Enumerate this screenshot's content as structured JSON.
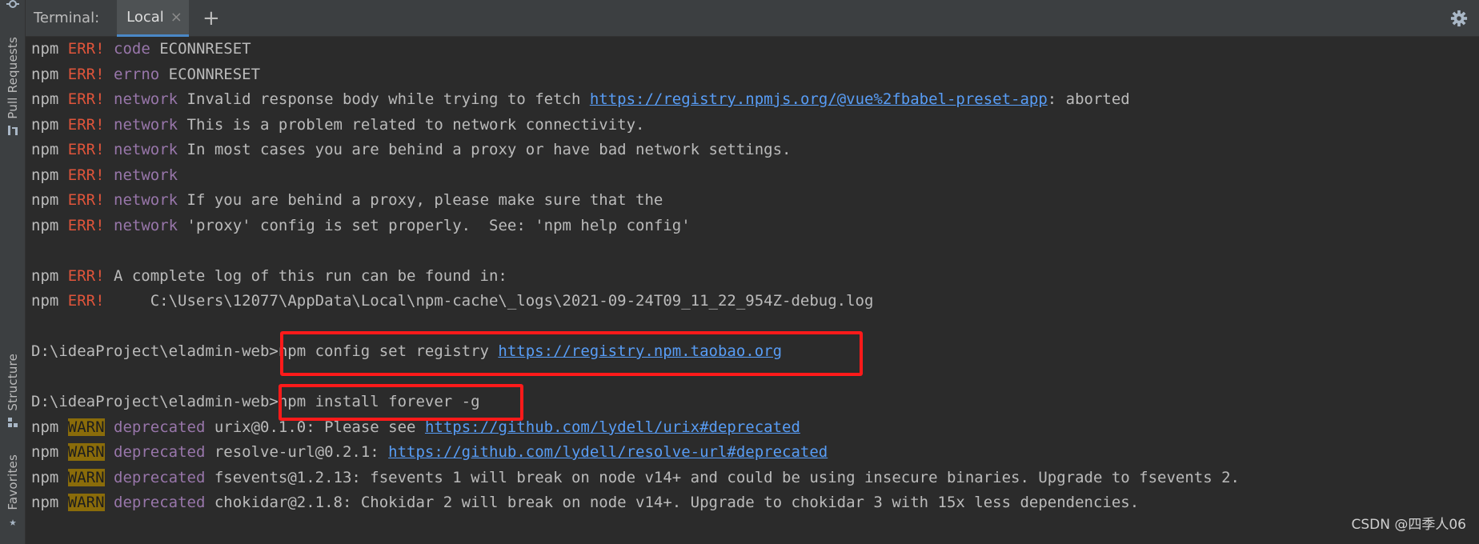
{
  "header": {
    "title": "Terminal:",
    "tab_label": "Local",
    "tab_close": "×",
    "add_tab": "+"
  },
  "side_tabs": {
    "pull_requests": "Pull Requests",
    "structure": "Structure",
    "favorites": "Favorites"
  },
  "terminal_lines": {
    "l1": {
      "npm": "npm",
      "err": "ERR!",
      "kw": "code",
      "text": " ECONNRESET"
    },
    "l2": {
      "npm": "npm",
      "err": "ERR!",
      "kw": "errno",
      "text": " ECONNRESET"
    },
    "l3": {
      "npm": "npm",
      "err": "ERR!",
      "kw": "network",
      "text": " Invalid response body while trying to fetch ",
      "link": "https://registry.npmjs.org/@vue%2fbabel-preset-app",
      "tail": ": aborted"
    },
    "l4": {
      "npm": "npm",
      "err": "ERR!",
      "kw": "network",
      "text": " This is a problem related to network connectivity."
    },
    "l5": {
      "npm": "npm",
      "err": "ERR!",
      "kw": "network",
      "text": " In most cases you are behind a proxy or have bad network settings."
    },
    "l6": {
      "npm": "npm",
      "err": "ERR!",
      "kw": "network",
      "text": ""
    },
    "l7": {
      "npm": "npm",
      "err": "ERR!",
      "kw": "network",
      "text": " If you are behind a proxy, please make sure that the"
    },
    "l8": {
      "npm": "npm",
      "err": "ERR!",
      "kw": "network",
      "text": " 'proxy' config is set properly.  See: 'npm help config'"
    },
    "l9": {
      "npm": "npm",
      "err": "ERR!",
      "text": " A complete log of this run can be found in:"
    },
    "l10": {
      "npm": "npm",
      "err": "ERR!",
      "text": "     C:\\Users\\12077\\AppData\\Local\\npm-cache\\_logs\\2021-09-24T09_11_22_954Z-debug.log"
    },
    "l11": {
      "prompt": "D:\\ideaProject\\eladmin-web>",
      "cmd": "npm config set registry ",
      "link": "https://registry.npm.taobao.org"
    },
    "l12": {
      "prompt": "D:\\ideaProject\\eladmin-web>",
      "cmd": "npm install forever -g"
    },
    "l13": {
      "npm": "npm",
      "warn": "WARN",
      "kw": "deprecated",
      "text": " urix@0.1.0: Please see ",
      "link": "https://github.com/lydell/urix#deprecated"
    },
    "l14": {
      "npm": "npm",
      "warn": "WARN",
      "kw": "deprecated",
      "text": " resolve-url@0.2.1: ",
      "link": "https://github.com/lydell/resolve-url#deprecated"
    },
    "l15": {
      "npm": "npm",
      "warn": "WARN",
      "kw": "deprecated",
      "text": " fsevents@1.2.13: fsevents 1 will break on node v14+ and could be using insecure binaries. Upgrade to fsevents 2."
    },
    "l16": {
      "npm": "npm",
      "warn": "WARN",
      "kw": "deprecated",
      "text": " chokidar@2.1.8: Chokidar 2 will break on node v14+. Upgrade to chokidar 3 with 15x less dependencies."
    }
  },
  "watermark": "CSDN @四季人06",
  "colors": {
    "background": "#2b2b2b",
    "err": "#e0553b",
    "keyword": "#9876aa",
    "link": "#589df6",
    "warn_bg": "#8a6c0a",
    "highlight_box": "#ff1a1a"
  },
  "icons": {
    "top": "pin-icon",
    "pull_requests": "pull-request-icon",
    "structure": "structure-icon",
    "favorites": "star-icon",
    "settings": "gear-icon"
  }
}
